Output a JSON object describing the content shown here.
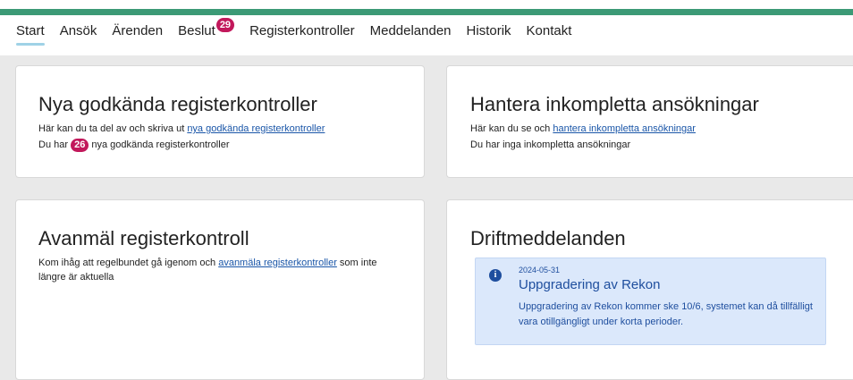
{
  "nav": {
    "items": [
      {
        "label": "Start"
      },
      {
        "label": "Ansök"
      },
      {
        "label": "Ärenden"
      },
      {
        "label": "Beslut",
        "badge": "29"
      },
      {
        "label": "Registerkontroller"
      },
      {
        "label": "Meddelanden"
      },
      {
        "label": "Historik"
      },
      {
        "label": "Kontakt"
      }
    ],
    "active": "Start"
  },
  "colors": {
    "accent": "#3c9a76",
    "badge": "#c2185b",
    "link": "#1a56a8",
    "info_bg": "#dbe8fb"
  },
  "cards": {
    "new_controls": {
      "title": "Nya godkända registerkontroller",
      "line1_prefix": "Här kan du ta del av och skriva ut ",
      "line1_link": "nya godkända registerkontroller",
      "line2_prefix": "Du har ",
      "line2_count": "26",
      "line2_suffix": " nya godkända registerkontroller"
    },
    "incomplete": {
      "title": "Hantera inkompletta ansökningar",
      "line1_prefix": "Här kan du se och ",
      "line1_link": "hantera inkompletta ansökningar",
      "line2": "Du har inga inkompletta ansökningar"
    },
    "deregister": {
      "title": "Avanmäl registerkontroll",
      "text_prefix": "Kom ihåg att regelbundet gå igenom och ",
      "text_link": "avanmäla registerkontroller",
      "text_suffix": " som inte längre är aktuella"
    },
    "ops": {
      "title": "Driftmeddelanden",
      "message": {
        "icon": "info-icon",
        "date": "2024-05-31",
        "title": "Uppgradering av Rekon",
        "body": "Uppgradering av Rekon kommer ske 10/6, systemet kan då tillfälligt vara otillgängligt under korta perioder."
      }
    }
  }
}
